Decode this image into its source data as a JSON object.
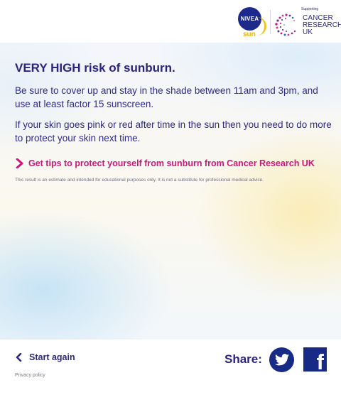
{
  "header": {
    "nivea_logo": {
      "badge_text": "NIVEA",
      "sun_text": "sun"
    },
    "cruk_logo": {
      "supporting_text": "Supporting",
      "lines": [
        "CANCER",
        "RESEARCH",
        "UK"
      ]
    }
  },
  "result": {
    "title": "VERY HIGH risk of sunburn.",
    "paragraph_1": "Be sure to cover up and stay in the shade between 11am and 3pm, and use at least factor 15 sunscreen.",
    "paragraph_2": "If your skin goes pink or red after time in the sun then you need to do more to protect your skin next time.",
    "tips_link": "Get tips to protect yourself from sunburn from Cancer Research UK",
    "disclaimer": "This result is an estimate and intended for educational purposes only. It is not a substitute for professional medical advice."
  },
  "footer": {
    "start_again": "Start again",
    "privacy": "Privacy policy",
    "share_label": "Share:",
    "facebook_glyph": "f"
  },
  "colors": {
    "navy": "#2b2380",
    "magenta": "#d0167a",
    "social_blue": "#162a86",
    "sun_yellow": "#f3c21b"
  },
  "icons": [
    "chevron-right-icon",
    "chevron-left-icon",
    "twitter-icon",
    "facebook-icon",
    "cruk-logo-mark"
  ]
}
